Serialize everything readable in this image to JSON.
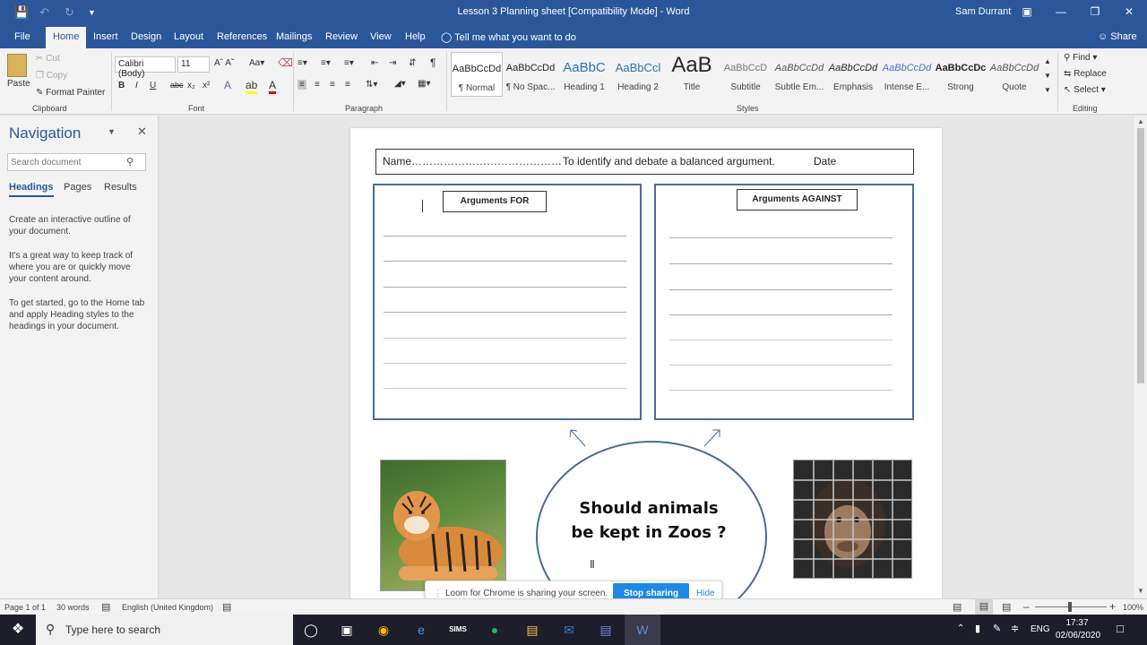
{
  "titlebar": {
    "title": "Lesson 3 Planning sheet [Compatibility Mode]  -  Word",
    "user": "Sam Durrant"
  },
  "menu": {
    "tabs": [
      "File",
      "Home",
      "Insert",
      "Design",
      "Layout",
      "References",
      "Mailings",
      "Review",
      "View",
      "Help"
    ],
    "active_tab": "Home",
    "tell_me": "Tell me what you want to do",
    "share": "Share"
  },
  "ribbon": {
    "clipboard": {
      "paste": "Paste",
      "cut": "Cut",
      "copy": "Copy",
      "format_painter": "Format Painter",
      "label": "Clipboard"
    },
    "font": {
      "name": "Calibri (Body)",
      "size": "11",
      "label": "Font"
    },
    "paragraph": {
      "label": "Paragraph"
    },
    "styles": {
      "label": "Styles",
      "items": [
        {
          "preview": "AaBbCcDd",
          "name": "¶ Normal"
        },
        {
          "preview": "AaBbCcDd",
          "name": "¶ No Spac..."
        },
        {
          "preview": "AaBbC",
          "name": "Heading 1"
        },
        {
          "preview": "AaBbCcl",
          "name": "Heading 2"
        },
        {
          "preview": "AaB",
          "name": "Title"
        },
        {
          "preview": "AaBbCcD",
          "name": "Subtitle"
        },
        {
          "preview": "AaBbCcDd",
          "name": "Subtle Em..."
        },
        {
          "preview": "AaBbCcDd",
          "name": "Emphasis"
        },
        {
          "preview": "AaBbCcDd",
          "name": "Intense E..."
        },
        {
          "preview": "AaBbCcDc",
          "name": "Strong"
        },
        {
          "preview": "AaBbCcDd",
          "name": "Quote"
        }
      ]
    },
    "editing": {
      "find": "Find",
      "replace": "Replace",
      "select": "Select",
      "label": "Editing"
    }
  },
  "nav": {
    "title": "Navigation",
    "search_placeholder": "Search document",
    "tabs": [
      "Headings",
      "Pages",
      "Results"
    ],
    "p1": "Create an interactive outline of your document.",
    "p2": "It's a great way to keep track of where you are or quickly move your content around.",
    "p3": "To get started, go to the Home tab and apply Heading styles to the headings in your document."
  },
  "document": {
    "name_label": "Name……………………………………",
    "objective": "To identify and debate a balanced argument.",
    "date_label": "Date",
    "for_label": "Arguments FOR",
    "against_label": "Arguments AGAINST",
    "question_line1": "Should animals",
    "question_line2": "be kept in Zoos ?"
  },
  "loom": {
    "message": "Loom for Chrome is sharing your screen.",
    "stop": "Stop sharing",
    "hide": "Hide"
  },
  "status": {
    "page": "Page 1 of 1",
    "words": "30 words",
    "language": "English (United Kingdom)",
    "zoom": "100%"
  },
  "taskbar": {
    "search_placeholder": "Type here to search",
    "time": "17:37",
    "date": "02/06/2020",
    "lang": "ENG"
  },
  "colors": {
    "word_blue": "#2b579a",
    "box_border": "#4a6b9a",
    "loom_button": "#1e88e5"
  }
}
